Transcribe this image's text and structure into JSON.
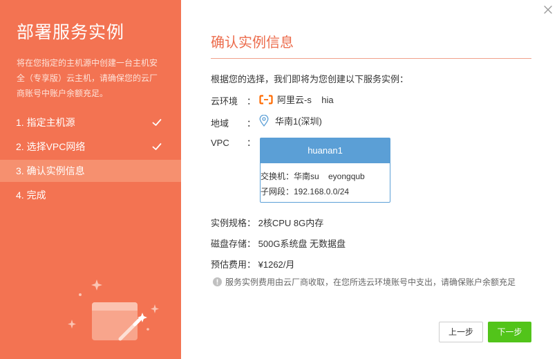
{
  "sidebar": {
    "title": "部署服务实例",
    "description": "将在您指定的主机源中创建一台主机安全（专享版）云主机，请确保您的云厂商账号中账户余额充足。",
    "steps": [
      {
        "label": "1. 指定主机源",
        "done": true
      },
      {
        "label": "2. 选择VPC网络",
        "done": true
      },
      {
        "label": "3. 确认实例信息",
        "active": true
      },
      {
        "label": "4. 完成"
      }
    ]
  },
  "main": {
    "title": "确认实例信息",
    "intro": "根据您的选择，我们即将为您创建以下服务实例：",
    "cloud": {
      "label": "云环境",
      "colon": "：",
      "value": "阿里云-s    hia"
    },
    "region": {
      "label": "地域",
      "colon": "：",
      "value": "华南1(深圳)"
    },
    "vpc": {
      "label": "VPC",
      "colon": "：",
      "name": "huanan1",
      "switch": "交换机：华南su    eyongqub",
      "subnet": "子网段：192.168.0.0/24"
    },
    "spec": {
      "label": "实例规格：",
      "value": "2核CPU 8G内存"
    },
    "disk": {
      "label": "磁盘存储：",
      "value": "500G系统盘 无数据盘"
    },
    "cost": {
      "label": "预估费用：",
      "value": "¥1262/月"
    },
    "notice": "服务实例费用由云厂商收取，在您所选云环境账号中支出，请确保账户余额充足"
  },
  "buttons": {
    "prev": "上一步",
    "next": "下一步"
  },
  "colors": {
    "sidebar_bg": "#f37352",
    "accent": "#ec6c4c",
    "vpc_blue": "#5b9fd6",
    "next_green": "#52c41a"
  }
}
